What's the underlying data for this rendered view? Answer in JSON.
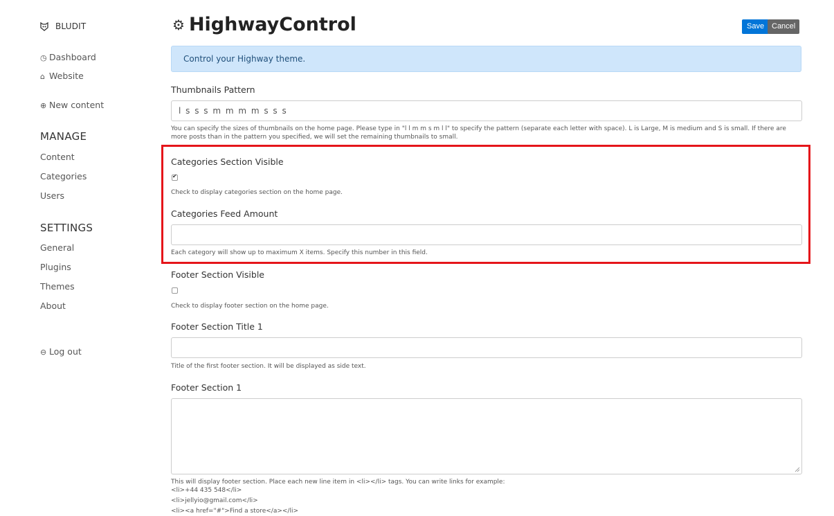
{
  "sidebar": {
    "brand": "BLUDIT",
    "links": {
      "dashboard": "Dashboard",
      "website": "Website",
      "new_content": "New content",
      "logout": "Log out"
    },
    "manage": {
      "heading": "MANAGE",
      "items": [
        "Content",
        "Categories",
        "Users"
      ]
    },
    "settings": {
      "heading": "SETTINGS",
      "items": [
        "General",
        "Plugins",
        "Themes",
        "About"
      ]
    }
  },
  "page": {
    "title": "HighwayControl",
    "save_label": "Save",
    "cancel_label": "Cancel",
    "alert": "Control your Highway theme."
  },
  "form": {
    "thumbnails": {
      "label": "Thumbnails Pattern",
      "value": "l s s s m m m m s s s",
      "help": "You can specify the sizes of thumbnails on the home page. Please type in \"l l m m s m l l\" to specify the pattern (separate each letter with space). L is Large, M is medium and S is small. If there are more posts than in the pattern you specified, we will set the remaining thumbnails to small."
    },
    "categories_visible": {
      "label": "Categories Section Visible",
      "checked": true,
      "help": "Check to display categories section on the home page."
    },
    "categories_feed": {
      "label": "Categories Feed Amount",
      "value": "",
      "help": "Each category will show up to maximum X items. Specify this number in this field."
    },
    "footer_visible": {
      "label": "Footer Section Visible",
      "checked": false,
      "help": "Check to display footer section on the home page."
    },
    "footer_title_1": {
      "label": "Footer Section Title 1",
      "value": "",
      "help": "Title of the first footer section. It will be displayed as side text."
    },
    "footer_section_1": {
      "label": "Footer Section 1",
      "value": "",
      "help": "This will display footer section. Place each new line item in <li></li> tags. You can write links for example:",
      "examples": [
        "<li>+44 435 548</li>",
        "<li>jellyio@gmail.com</li>",
        "<li><a href=\"#\">Find a store</a></li>"
      ]
    }
  },
  "colors": {
    "primary": "#0275d8",
    "highlight": "#e5151a",
    "alert_bg": "#cfe6fb"
  },
  "icons": [
    "bludit-logo-icon",
    "dashboard-icon",
    "home-icon",
    "plus-circle-icon",
    "logout-icon",
    "gear-icon"
  ]
}
